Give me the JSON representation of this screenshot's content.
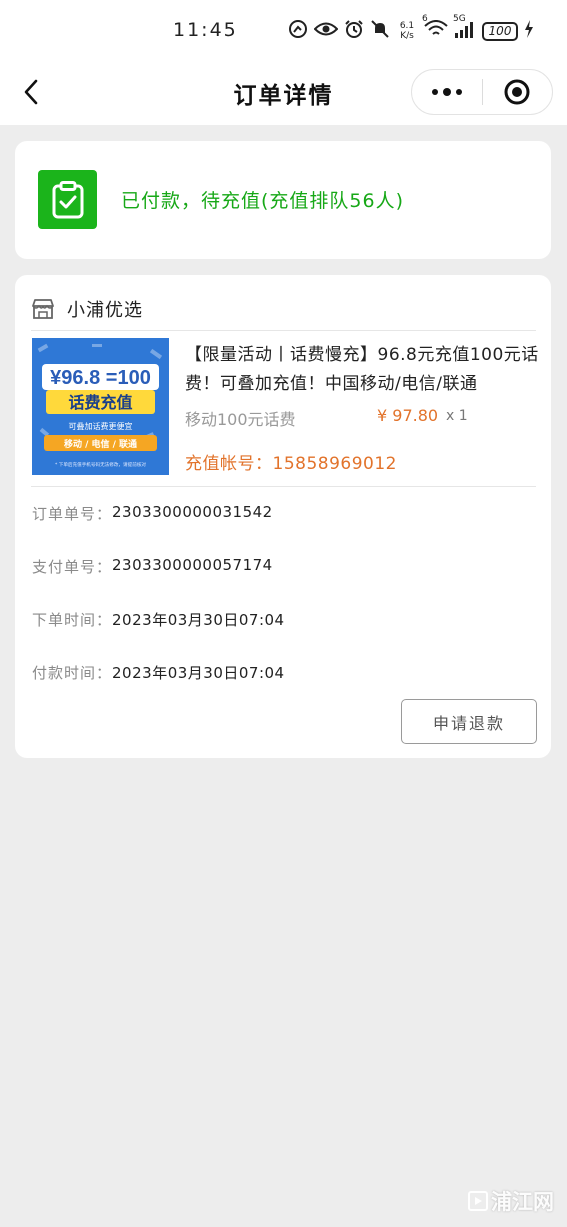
{
  "status_bar": {
    "time": "11:45",
    "net_speed_value": "6.1",
    "net_speed_unit": "K/s",
    "wifi_label": "6",
    "signal_label": "5G",
    "battery": "100",
    "icons": [
      "hd-call-icon",
      "eye-icon",
      "alarm-icon",
      "mute-icon",
      "wifi-icon",
      "signal-icon",
      "battery-icon",
      "charging-icon"
    ]
  },
  "nav": {
    "title": "订单详情",
    "back_icon": "chevron-left-icon",
    "more_icon": "more-dots-icon",
    "close_icon": "target-circle-icon"
  },
  "order_status": {
    "text": "已付款，待充值(充值排队56人)",
    "icon": "clipboard-check-icon",
    "color": "#1bb41b"
  },
  "shop": {
    "name": "小浦优选",
    "icon": "store-icon"
  },
  "product": {
    "title": "【限量活动丨话费慢充】96.8元充值100元话费！可叠加充值！中国移动/电信/联通",
    "spec": "移动100元话费",
    "price": "¥ 97.80",
    "quantity": "x 1",
    "account_label": "充值帐号：",
    "account": "15858969012",
    "image": {
      "big_text_a": "96.8",
      "big_text_b": "=100",
      "banner": "话费充值",
      "sub": "可叠加话费更便宜",
      "carriers": "移动 / 电信 / 联通",
      "footnote": "* 下单后充值手机号码无法修改，请提前核对",
      "colors": {
        "bg": "#2f78d6",
        "banner": "#ffd93b",
        "accent": "#f5a623"
      }
    }
  },
  "info": [
    {
      "label": "订单单号：",
      "value": "2303300000031542"
    },
    {
      "label": "支付单号：",
      "value": "2303300000057174"
    },
    {
      "label": "下单时间：",
      "value": "2023年03月30日07:04"
    },
    {
      "label": "付款时间：",
      "value": "2023年03月30日07:04"
    }
  ],
  "actions": {
    "refund_label": "申请退款"
  },
  "watermark": "浦江网"
}
